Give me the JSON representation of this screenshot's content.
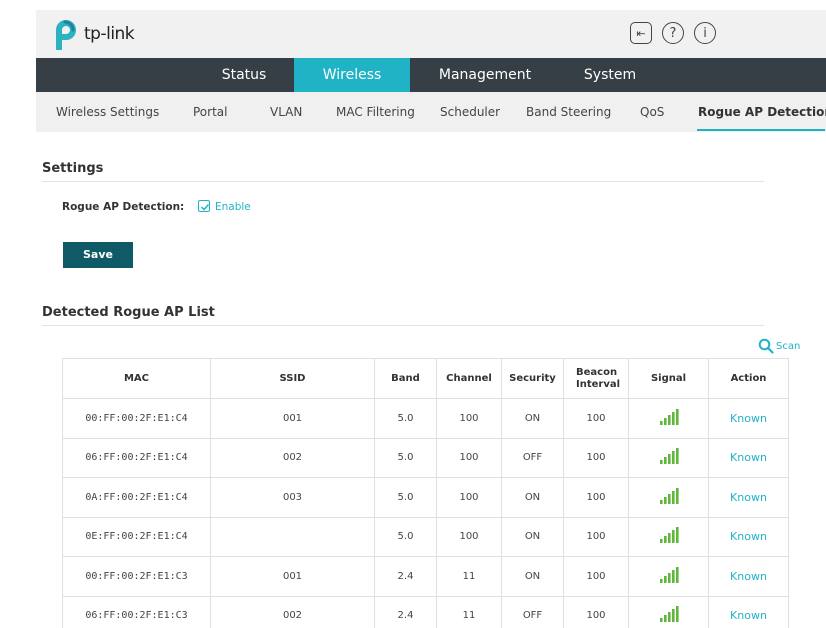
{
  "brand": {
    "logo_text": "tp-link",
    "accent": "#20b3c6",
    "nav_bg": "#363f45",
    "button_bg": "#0e5a67"
  },
  "header_icons": [
    {
      "name": "logout-icon",
      "glyph": "⇤"
    },
    {
      "name": "help-icon",
      "glyph": "?"
    },
    {
      "name": "info-icon",
      "glyph": "i"
    }
  ],
  "main_nav": [
    {
      "label": "Status",
      "active": false
    },
    {
      "label": "Wireless",
      "active": true
    },
    {
      "label": "Management",
      "active": false
    },
    {
      "label": "System",
      "active": false
    }
  ],
  "sub_nav": [
    {
      "label": "Wireless Settings",
      "active": false
    },
    {
      "label": "Portal",
      "active": false
    },
    {
      "label": "VLAN",
      "active": false
    },
    {
      "label": "MAC Filtering",
      "active": false
    },
    {
      "label": "Scheduler",
      "active": false
    },
    {
      "label": "Band Steering",
      "active": false
    },
    {
      "label": "QoS",
      "active": false
    },
    {
      "label": "Rogue AP Detection",
      "active": true
    }
  ],
  "settings": {
    "title": "Settings",
    "rogue_label": "Rogue AP Detection:",
    "enable_label": "Enable",
    "enabled": true,
    "save_label": "Save"
  },
  "rogue_list": {
    "title": "Detected Rogue AP List",
    "scan_label": "Scan",
    "columns": [
      "MAC",
      "SSID",
      "Band",
      "Channel",
      "Security",
      "Beacon Interval",
      "Signal",
      "Action"
    ],
    "rows": [
      {
        "mac": "00:FF:00:2F:E1:C4",
        "ssid": "001",
        "band": "5.0",
        "channel": "100",
        "security": "ON",
        "beacon": "100",
        "signal_bars": 5,
        "action": "Known"
      },
      {
        "mac": "06:FF:00:2F:E1:C4",
        "ssid": "002",
        "band": "5.0",
        "channel": "100",
        "security": "OFF",
        "beacon": "100",
        "signal_bars": 5,
        "action": "Known"
      },
      {
        "mac": "0A:FF:00:2F:E1:C4",
        "ssid": "003",
        "band": "5.0",
        "channel": "100",
        "security": "ON",
        "beacon": "100",
        "signal_bars": 5,
        "action": "Known"
      },
      {
        "mac": "0E:FF:00:2F:E1:C4",
        "ssid": "",
        "band": "5.0",
        "channel": "100",
        "security": "ON",
        "beacon": "100",
        "signal_bars": 5,
        "action": "Known"
      },
      {
        "mac": "00:FF:00:2F:E1:C3",
        "ssid": "001",
        "band": "2.4",
        "channel": "11",
        "security": "ON",
        "beacon": "100",
        "signal_bars": 5,
        "action": "Known"
      },
      {
        "mac": "06:FF:00:2F:E1:C3",
        "ssid": "002",
        "band": "2.4",
        "channel": "11",
        "security": "OFF",
        "beacon": "100",
        "signal_bars": 5,
        "action": "Known"
      }
    ]
  }
}
